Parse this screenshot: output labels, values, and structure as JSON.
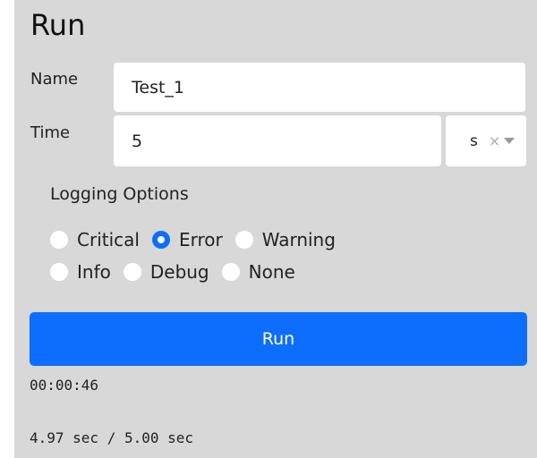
{
  "panel": {
    "title": "Run"
  },
  "form": {
    "name_label": "Name",
    "name_value": "Test_1",
    "time_label": "Time",
    "time_value": "5",
    "unit_value": "s",
    "clear_icon": "×"
  },
  "logging": {
    "title": "Logging Options",
    "options": [
      {
        "label": "Critical",
        "checked": false
      },
      {
        "label": "Error",
        "checked": true
      },
      {
        "label": "Warning",
        "checked": false
      },
      {
        "label": "Info",
        "checked": false
      },
      {
        "label": "Debug",
        "checked": false
      },
      {
        "label": "None",
        "checked": false
      }
    ],
    "selected": "Error"
  },
  "run_button": {
    "label": "Run"
  },
  "status": {
    "elapsed": "00:00:46",
    "progress_text": "4.97 sec / 5.00 sec"
  },
  "colors": {
    "accent": "#0d6efd",
    "panel_bg": "#d8d8d8"
  }
}
